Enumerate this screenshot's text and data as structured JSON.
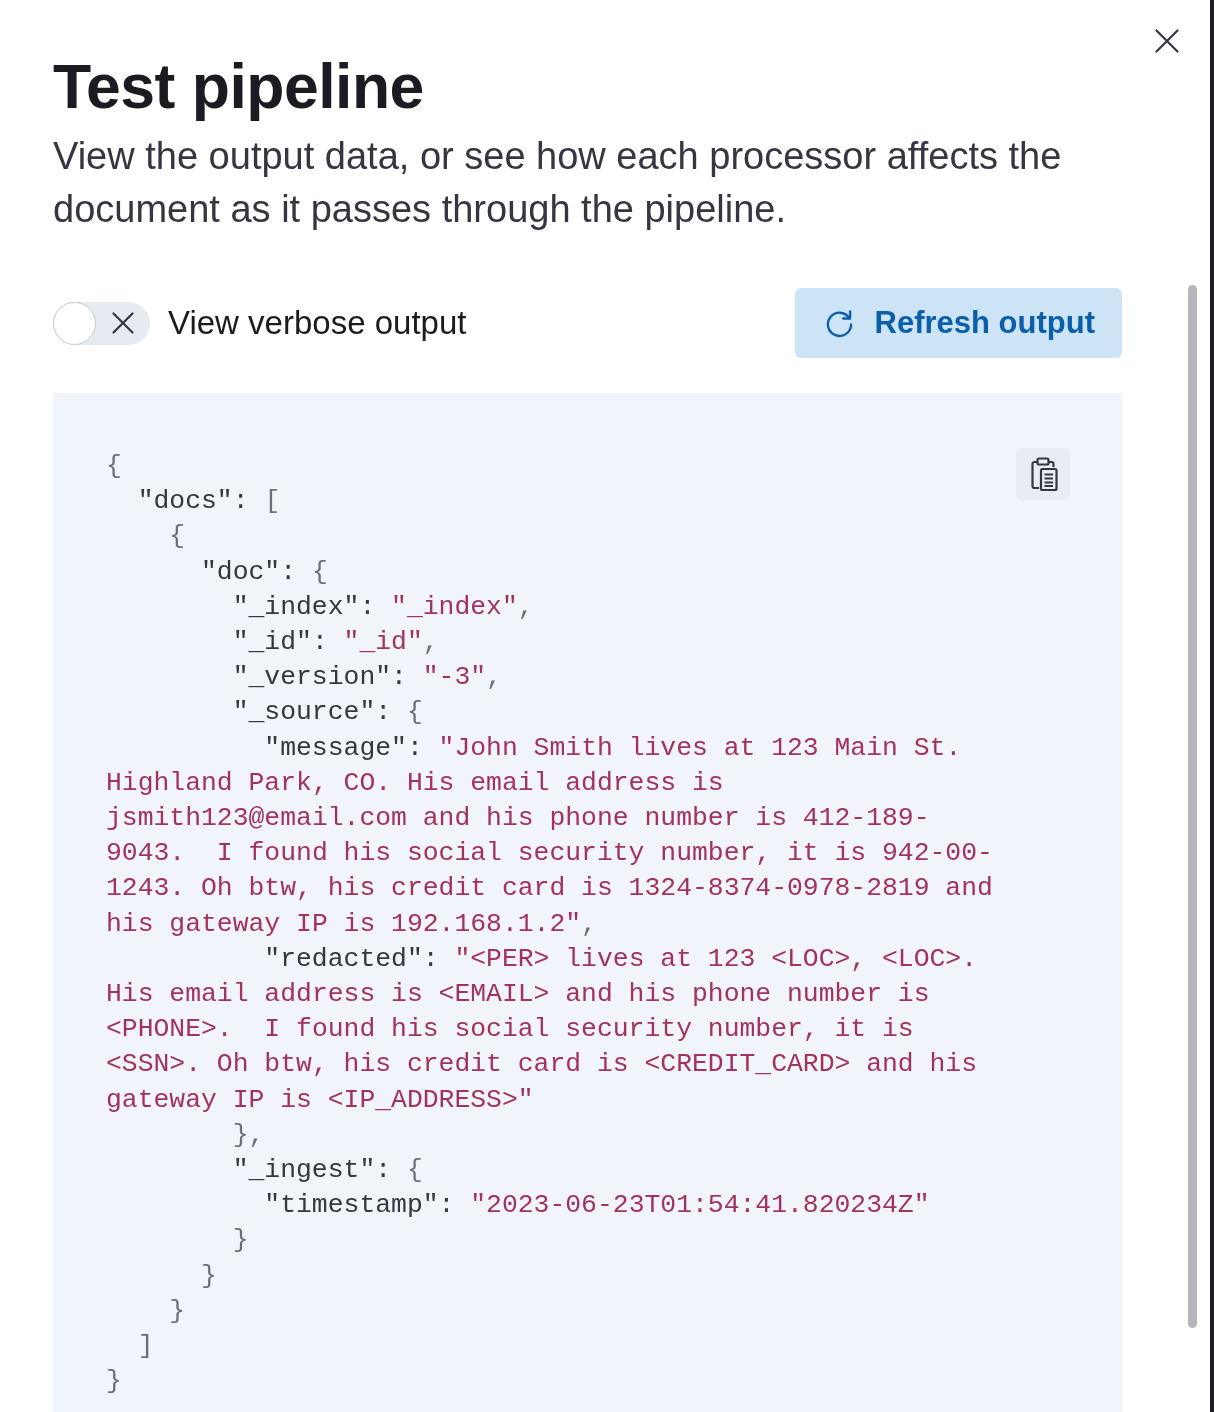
{
  "flyout": {
    "title": "Test pipeline",
    "description": "View the output data, or see how each processor affects the document as it passes through the pipeline."
  },
  "controls": {
    "verbose_toggle": {
      "label": "View verbose output",
      "checked": false
    },
    "refresh_button": {
      "label": "Refresh output"
    }
  },
  "output": {
    "code": [
      {
        "tokens": [
          {
            "kind": "bracket",
            "text": "{"
          }
        ],
        "children": [
          {
            "tokens": [
              {
                "kind": "key",
                "text": "\"docs\""
              },
              {
                "kind": "colon",
                "text": ":"
              },
              {
                "kind": "bracket",
                "text": "["
              }
            ],
            "children": [
              {
                "tokens": [
                  {
                    "kind": "bracket",
                    "text": "{"
                  }
                ],
                "children": [
                  {
                    "tokens": [
                      {
                        "kind": "key",
                        "text": "\"doc\""
                      },
                      {
                        "kind": "colon",
                        "text": ":"
                      },
                      {
                        "kind": "bracket",
                        "text": "{"
                      }
                    ],
                    "children": [
                      {
                        "tokens": [
                          {
                            "kind": "key",
                            "text": "\"_index\""
                          },
                          {
                            "kind": "colon",
                            "text": ":"
                          },
                          {
                            "kind": "string",
                            "text": "\"_index\""
                          },
                          {
                            "kind": "comma",
                            "text": ","
                          }
                        ]
                      },
                      {
                        "tokens": [
                          {
                            "kind": "key",
                            "text": "\"_id\""
                          },
                          {
                            "kind": "colon",
                            "text": ":"
                          },
                          {
                            "kind": "string",
                            "text": "\"_id\""
                          },
                          {
                            "kind": "comma",
                            "text": ","
                          }
                        ]
                      },
                      {
                        "tokens": [
                          {
                            "kind": "key",
                            "text": "\"_version\""
                          },
                          {
                            "kind": "colon",
                            "text": ":"
                          },
                          {
                            "kind": "string",
                            "text": "\"-3\""
                          },
                          {
                            "kind": "comma",
                            "text": ","
                          }
                        ]
                      },
                      {
                        "tokens": [
                          {
                            "kind": "key",
                            "text": "\"_source\""
                          },
                          {
                            "kind": "colon",
                            "text": ":"
                          },
                          {
                            "kind": "bracket",
                            "text": "{"
                          }
                        ],
                        "children": [
                          {
                            "tokens": [
                              {
                                "kind": "key",
                                "text": "\"message\""
                              },
                              {
                                "kind": "colon",
                                "text": ":"
                              },
                              {
                                "kind": "string",
                                "text": "\"John Smith lives at 123 Main St. Highland Park, CO. His email address is jsmith123@email.com and his phone number is 412-189-9043.  I found his social security number, it is 942-00-1243. Oh btw, his credit card is 1324-8374-0978-2819 and his gateway IP is 192.168.1.2\""
                              },
                              {
                                "kind": "comma",
                                "text": ","
                              }
                            ]
                          },
                          {
                            "tokens": [
                              {
                                "kind": "key",
                                "text": "\"redacted\""
                              },
                              {
                                "kind": "colon",
                                "text": ":"
                              },
                              {
                                "kind": "string",
                                "text": "\"<PER> lives at 123 <LOC>, <LOC>. His email address is <EMAIL> and his phone number is <PHONE>.  I found his social security number, it is <SSN>. Oh btw, his credit card is <CREDIT_CARD> and his gateway IP is <IP_ADDRESS>\""
                              }
                            ]
                          }
                        ]
                      },
                      {
                        "tokens": [
                          {
                            "kind": "bracket",
                            "text": "}"
                          },
                          {
                            "kind": "comma",
                            "text": ","
                          }
                        ]
                      },
                      {
                        "tokens": [
                          {
                            "kind": "key",
                            "text": "\"_ingest\""
                          },
                          {
                            "kind": "colon",
                            "text": ":"
                          },
                          {
                            "kind": "bracket",
                            "text": "{"
                          }
                        ],
                        "children": [
                          {
                            "tokens": [
                              {
                                "kind": "key",
                                "text": "\"timestamp\""
                              },
                              {
                                "kind": "colon",
                                "text": ":"
                              },
                              {
                                "kind": "string",
                                "text": "\"2023-06-23T01:54:41.820234Z\""
                              }
                            ]
                          }
                        ]
                      },
                      {
                        "tokens": [
                          {
                            "kind": "bracket",
                            "text": "}"
                          }
                        ]
                      }
                    ]
                  },
                  {
                    "tokens": [
                      {
                        "kind": "bracket",
                        "text": "}"
                      }
                    ]
                  }
                ]
              },
              {
                "tokens": [
                  {
                    "kind": "bracket",
                    "text": "}"
                  }
                ]
              }
            ]
          },
          {
            "tokens": [
              {
                "kind": "bracket",
                "text": "]"
              }
            ]
          }
        ]
      },
      {
        "tokens": [
          {
            "kind": "bracket",
            "text": "}"
          }
        ]
      }
    ]
  }
}
